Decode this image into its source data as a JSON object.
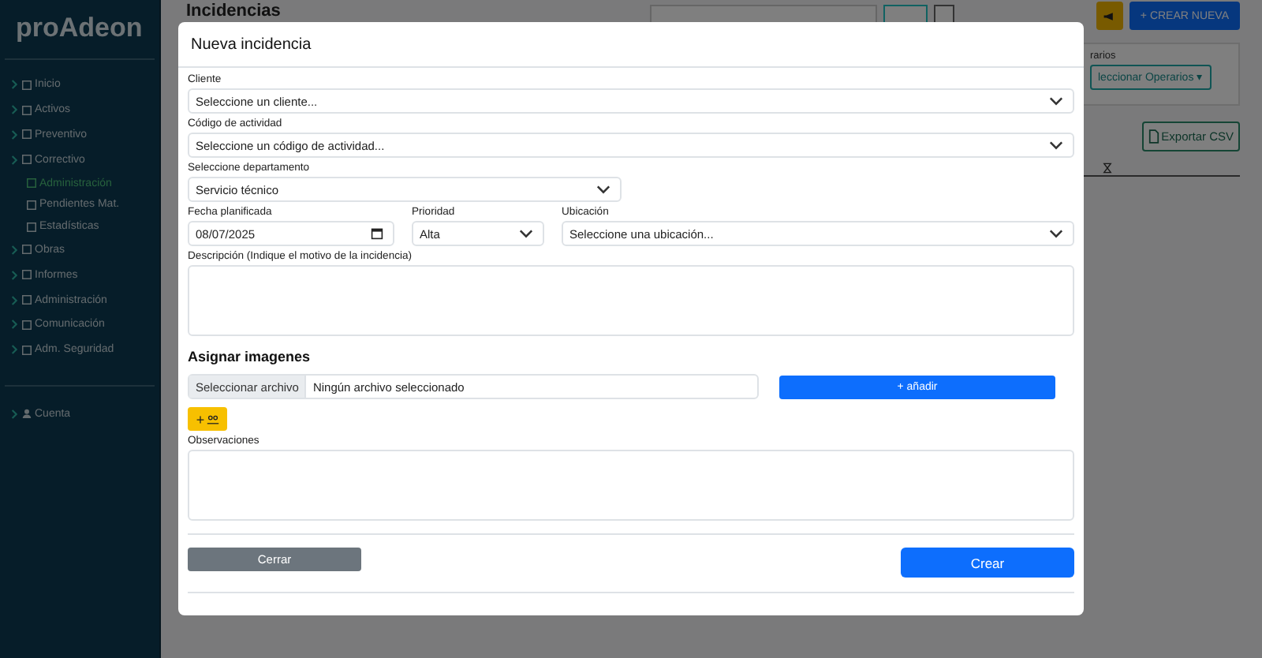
{
  "sidebar": {
    "logo": "proAdeon",
    "items": [
      {
        "label": "Inicio",
        "kind": "section",
        "selected": false
      },
      {
        "label": "Activos",
        "kind": "section",
        "selected": false
      },
      {
        "label": "Preventivo",
        "kind": "section",
        "selected": false
      },
      {
        "label": "Correctivo",
        "kind": "section",
        "selected": false
      },
      {
        "label": "Administración",
        "kind": "sub",
        "selected": true
      },
      {
        "label": "Pendientes Mat.",
        "kind": "sub",
        "selected": false
      },
      {
        "label": "Estadísticas",
        "kind": "sub",
        "selected": false
      },
      {
        "label": "Obras",
        "kind": "section",
        "selected": false
      },
      {
        "label": "Informes",
        "kind": "section",
        "selected": false
      },
      {
        "label": "Administración",
        "kind": "section",
        "selected": false
      },
      {
        "label": "Comunicación",
        "kind": "section",
        "selected": false
      },
      {
        "label": "Adm. Seguridad",
        "kind": "section",
        "selected": false
      }
    ],
    "footer_items": [
      {
        "label": "Cuenta"
      }
    ]
  },
  "page": {
    "title": "Incidencias",
    "create_button": "+ CREAR NUEVA",
    "operarios_label": "rarios",
    "operarios_button": "leccionar Operarios",
    "operarios_caret": "▾",
    "export_button": "Exportar CSV"
  },
  "modal": {
    "title": "Nueva incidencia",
    "fields": [
      {
        "label": "Cliente",
        "kind": "select",
        "value": "Seleccione un cliente..."
      },
      {
        "label": "Código de actividad",
        "kind": "select",
        "value": "Seleccione un código de actividad..."
      },
      {
        "label": "Seleccione departamento",
        "kind": "select",
        "value": "Servicio técnico"
      }
    ],
    "date_row": [
      {
        "label": "Fecha planificada",
        "kind": "date",
        "value": "08/07/2025"
      },
      {
        "label": "Prioridad",
        "kind": "select",
        "value": "Alta"
      },
      {
        "label": "Ubicación",
        "kind": "select",
        "value": "Seleccione una ubicación..."
      }
    ],
    "description_label": "Descripción (Indique el motivo de la incidencia)",
    "images_heading": "Asignar imagenes",
    "file_button": "Seleccionar archivo",
    "file_status": "Ningún archivo seleccionado",
    "add_button": "+ añadir",
    "add_people_button": "+",
    "observations_label": "Observaciones",
    "close_button": "Cerrar",
    "create_button": "Crear"
  }
}
